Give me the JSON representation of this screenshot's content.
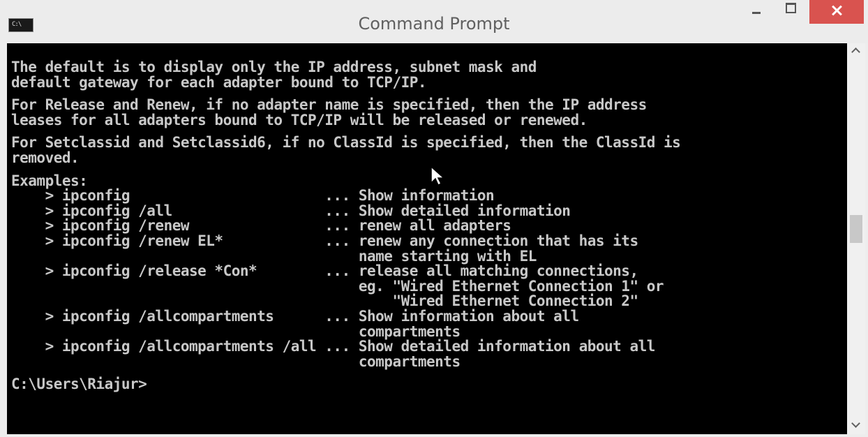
{
  "window": {
    "title": "Command Prompt"
  },
  "console": {
    "paragraphs": [
      [
        "The default is to display only the IP address, subnet mask and",
        "default gateway for each adapter bound to TCP/IP."
      ],
      [
        "For Release and Renew, if no adapter name is specified, then the IP address",
        "leases for all adapters bound to TCP/IP will be released or renewed."
      ],
      [
        "For Setclassid and Setclassid6, if no ClassId is specified, then the ClassId is",
        "removed."
      ]
    ],
    "examples_header": "Examples:",
    "examples": [
      "    > ipconfig                       ... Show information",
      "    > ipconfig /all                  ... Show detailed information",
      "    > ipconfig /renew                ... renew all adapters",
      "    > ipconfig /renew EL*            ... renew any connection that has its",
      "                                         name starting with EL",
      "    > ipconfig /release *Con*        ... release all matching connections,",
      "                                         eg. \"Wired Ethernet Connection 1\" or",
      "                                             \"Wired Ethernet Connection 2\"",
      "    > ipconfig /allcompartments      ... Show information about all",
      "                                         compartments",
      "    > ipconfig /allcompartments /all ... Show detailed information about all",
      "                                         compartments"
    ],
    "prompt": "C:\\Users\\Riajur>"
  },
  "colors": {
    "console_bg": "#000000",
    "console_text": "#c8c8c8",
    "close_button": "#d9534f"
  },
  "icons": [
    "cmd-app-icon",
    "minimize-icon",
    "maximize-icon",
    "close-icon",
    "scroll-up-icon",
    "scroll-down-icon",
    "mouse-pointer-icon"
  ]
}
